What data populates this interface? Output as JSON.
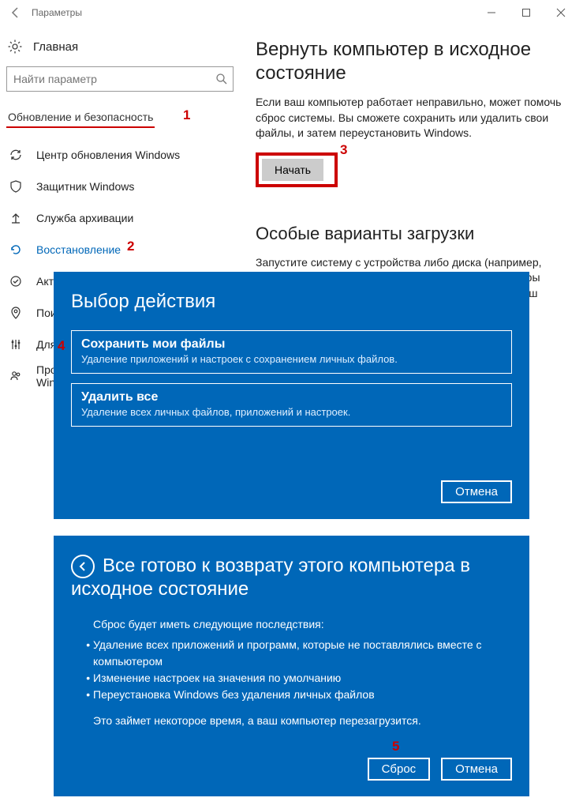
{
  "titlebar": {
    "title": "Параметры"
  },
  "sidebar": {
    "home": "Главная",
    "search_placeholder": "Найти параметр",
    "category": "Обновление и безопасность",
    "items": [
      {
        "icon": "sync-icon",
        "label": "Центр обновления Windows"
      },
      {
        "icon": "shield-icon",
        "label": "Защитник Windows"
      },
      {
        "icon": "archive-icon",
        "label": "Служба архивации"
      },
      {
        "icon": "restore-icon",
        "label": "Восстановление",
        "active": true
      },
      {
        "icon": "check-icon",
        "label": "Актив"
      },
      {
        "icon": "search-icon",
        "label": "Поис"
      },
      {
        "icon": "developer-icon",
        "label": "Для р"
      },
      {
        "icon": "program-icon",
        "label": "Прог\nWind"
      }
    ]
  },
  "content": {
    "reset_title": "Вернуть компьютер в исходное состояние",
    "reset_desc": "Если ваш компьютер работает неправильно, может помочь сброс системы. Вы сможете сохранить или удалить свои файлы, и затем переустановить Windows.",
    "reset_button": "Начать",
    "advanced_title": "Особые варианты загрузки",
    "advanced_desc": "Запустите систему с устройства либо диска (например, USB-накопителя или DVD-диска), измените параметры загрузки Windows или восстановите ее из образа. Ваш компьютер"
  },
  "panel_choice": {
    "title": "Выбор действия",
    "options": [
      {
        "title": "Сохранить мои файлы",
        "desc": "Удаление приложений и настроек с сохранением личных файлов."
      },
      {
        "title": "Удалить все",
        "desc": "Удаление всех личных файлов, приложений и настроек."
      }
    ],
    "cancel": "Отмена"
  },
  "panel_ready": {
    "title": "Все готово к возврату этого компьютера в исходное состояние",
    "intro": "Сброс будет иметь следующие последствия:",
    "bullets": [
      "Удаление всех приложений и программ, которые не поставлялись вместе с компьютером",
      "Изменение настроек на значения по умолчанию",
      "Переустановка Windows без удаления личных файлов"
    ],
    "footer": "Это займет некоторое время, а ваш компьютер перезагрузится.",
    "reset": "Сброс",
    "cancel": "Отмена"
  },
  "annotations": {
    "a1": "1",
    "a2": "2",
    "a3": "3",
    "a4": "4",
    "a5": "5"
  }
}
